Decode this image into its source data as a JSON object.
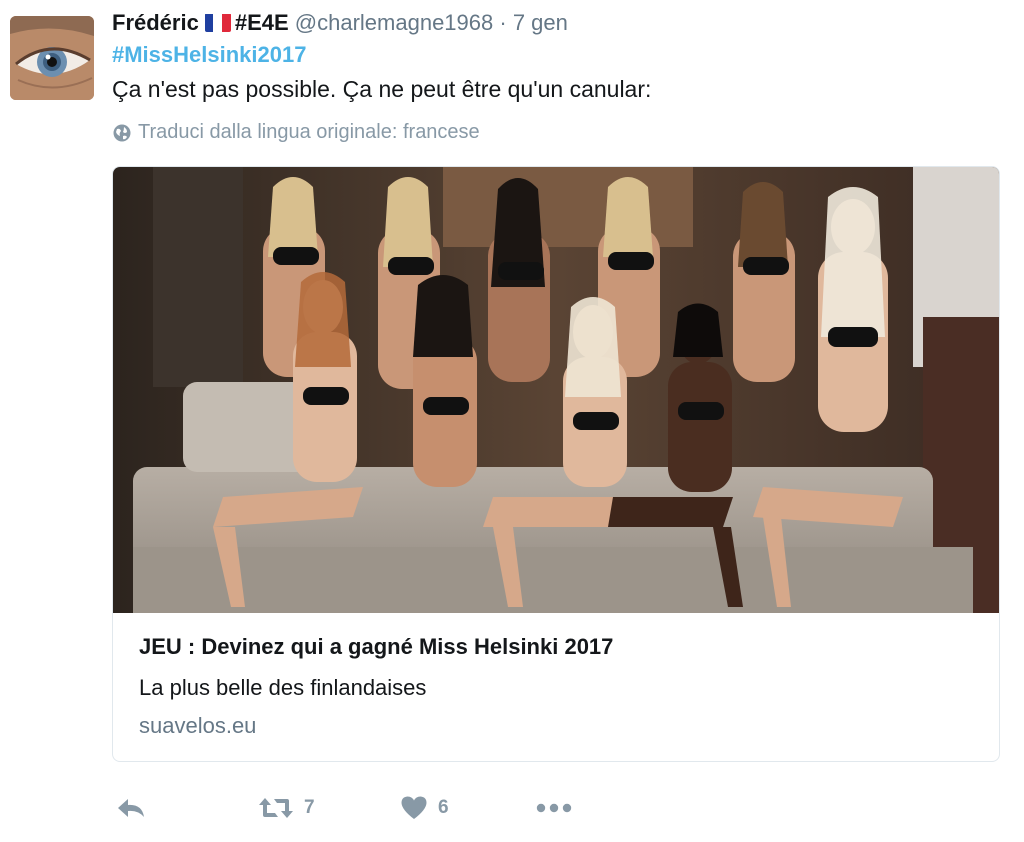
{
  "tweet": {
    "name": "Frédéric",
    "flag": "🇫🇷",
    "tag": "#E4E",
    "handle": "@charlemagne1968",
    "separator": "·",
    "time": "7 gen",
    "hashtag": "#MissHelsinki2017",
    "text": "Ça n'est pas possible. Ça ne peut être qu'un canular:",
    "translate_label": "Traduci dalla lingua originale: francese",
    "card": {
      "title": "JEU : Devinez qui a gagné Miss Helsinki 2017",
      "description": "La plus belle des finlandaises",
      "domain": "suavelos.eu"
    },
    "actions": {
      "reply_icon": "reply-icon",
      "retweet_icon": "retweet-icon",
      "retweet_count": "7",
      "like_icon": "heart-icon",
      "like_count": "6",
      "more_icon": "more-icon"
    }
  },
  "colors": {
    "hashtag": "#4db3e6",
    "muted": "#657786",
    "icon": "#8899a6",
    "border": "#e1e8ed"
  }
}
